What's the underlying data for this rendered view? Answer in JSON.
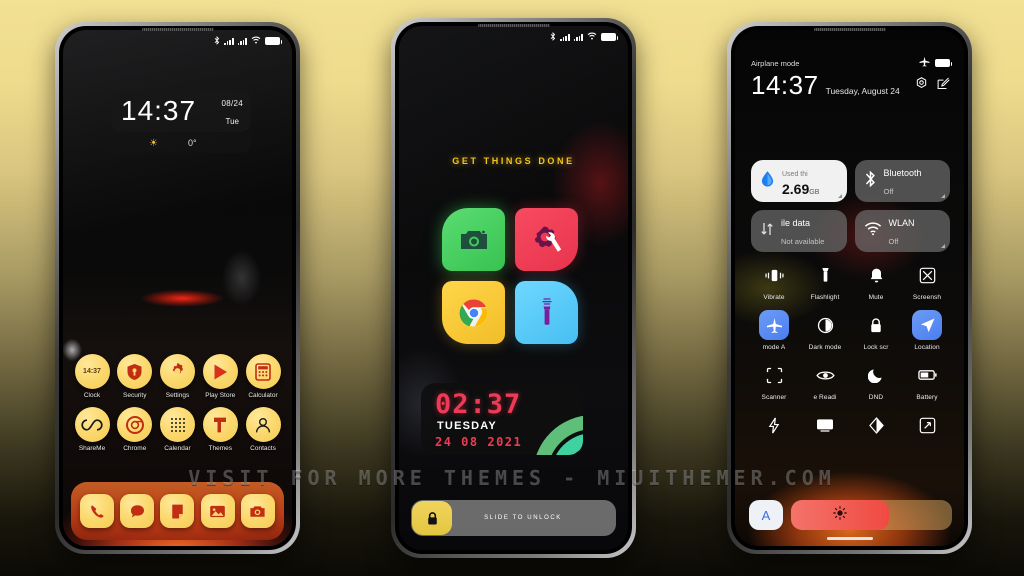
{
  "watermark": "VISIT FOR MORE THEMES - MIUITHEMER.COM",
  "background": {
    "top_color": "#f2e093",
    "bottom_color": "#0b0a05"
  },
  "phone1": {
    "name": "lock-home-screen",
    "statusbar": {
      "icons": [
        "bluetooth-icon",
        "signal-icon",
        "signal-icon",
        "wifi-icon",
        "battery-icon"
      ]
    },
    "clock_widget": {
      "time": "14:37",
      "date": "08/24",
      "weekday": "Tue"
    },
    "weather_widget": {
      "icon": "sun-icon",
      "temperature": "0°"
    },
    "apps_row1": [
      {
        "label": "Clock",
        "icon": "clock-icon",
        "badge": "14:37"
      },
      {
        "label": "Security",
        "icon": "shield-icon"
      },
      {
        "label": "Settings",
        "icon": "gear-icon"
      },
      {
        "label": "Play Store",
        "icon": "play-store-icon"
      },
      {
        "label": "Calculator",
        "icon": "calculator-icon"
      }
    ],
    "apps_row2": [
      {
        "label": "ShareMe",
        "icon": "shareme-icon"
      },
      {
        "label": "Chrome",
        "icon": "chrome-icon"
      },
      {
        "label": "Calendar",
        "icon": "calendar-icon"
      },
      {
        "label": "Themes",
        "icon": "themes-icon"
      },
      {
        "label": "Contacts",
        "icon": "contacts-icon"
      }
    ],
    "dock": [
      {
        "label": "Phone",
        "icon": "phone-icon"
      },
      {
        "label": "Messages",
        "icon": "message-icon"
      },
      {
        "label": "Notes",
        "icon": "notes-icon"
      },
      {
        "label": "Gallery",
        "icon": "gallery-icon"
      },
      {
        "label": "Camera",
        "icon": "camera-icon"
      }
    ]
  },
  "phone2": {
    "name": "lock-screen-tiles",
    "statusbar": {
      "icons": [
        "bluetooth-icon",
        "signal-icon",
        "signal-icon",
        "wifi-icon",
        "battery-icon"
      ]
    },
    "headline": "GET THINGS DONE",
    "tiles": [
      {
        "label": "Camera",
        "icon": "camera-icon",
        "color": "#3FCE59"
      },
      {
        "label": "Settings",
        "icon": "gear-wrench-icon",
        "color": "#EE3B52"
      },
      {
        "label": "Chrome",
        "icon": "chrome-icon",
        "color": "#F5C62C"
      },
      {
        "label": "Flashlight",
        "icon": "flashlight-icon",
        "color": "#4CC2F3"
      }
    ],
    "clock_widget": {
      "time": "02:37",
      "weekday": "TUESDAY",
      "date": "24 08 2021"
    },
    "unlock": {
      "icon": "lock-icon",
      "text": "SLIDE TO UNLOCK"
    }
  },
  "phone3": {
    "name": "control-center",
    "status_label": "Airplane mode",
    "status_icons": [
      "airplane-icon",
      "battery-icon"
    ],
    "time": "14:37",
    "date": "Tuesday, August 24",
    "actions": [
      "settings-gear-icon",
      "edit-icon"
    ],
    "big_tiles": [
      {
        "title": "Used thi",
        "value": "2.69",
        "unit": "GB",
        "icon": "data-drop-icon",
        "state": "on"
      },
      {
        "title": "Bluetooth",
        "subtitle": "Off",
        "icon": "bluetooth-icon",
        "state": "off"
      },
      {
        "title": "ile data",
        "subtitle": "Not available",
        "icon": "mobile-data-icon",
        "state": "off"
      },
      {
        "title": "WLAN",
        "subtitle": "Off",
        "icon": "wifi-icon",
        "state": "off"
      }
    ],
    "quick_settings": [
      {
        "label": "Vibrate",
        "icon": "vibrate-icon",
        "active": false
      },
      {
        "label": "Flashlight",
        "icon": "flashlight-icon",
        "active": false
      },
      {
        "label": "Mute",
        "icon": "bell-icon",
        "active": false
      },
      {
        "label": "Screensh",
        "icon": "screenshot-icon",
        "active": false
      },
      {
        "label": "mode      A",
        "icon": "airplane-icon",
        "active": true
      },
      {
        "label": "Dark mode",
        "icon": "dark-mode-icon",
        "active": false
      },
      {
        "label": "Lock scr",
        "icon": "lock-icon",
        "active": false
      },
      {
        "label": "Location",
        "icon": "location-icon",
        "active": true
      },
      {
        "label": "Scanner",
        "icon": "scanner-icon",
        "active": false
      },
      {
        "label": "e    Readi",
        "icon": "eye-icon",
        "active": false
      },
      {
        "label": "DND",
        "icon": "moon-icon",
        "active": false
      },
      {
        "label": "Battery",
        "icon": "battery-saver-icon",
        "active": false
      },
      {
        "label": "",
        "icon": "lightning-icon",
        "active": false
      },
      {
        "label": "",
        "icon": "cast-icon",
        "active": false
      },
      {
        "label": "",
        "icon": "contrast-icon",
        "active": false
      },
      {
        "label": "",
        "icon": "fullscreen-icon",
        "active": false
      }
    ],
    "brightness": {
      "auto_label": "A",
      "icon": "brightness-icon",
      "level_percent": 61
    }
  }
}
